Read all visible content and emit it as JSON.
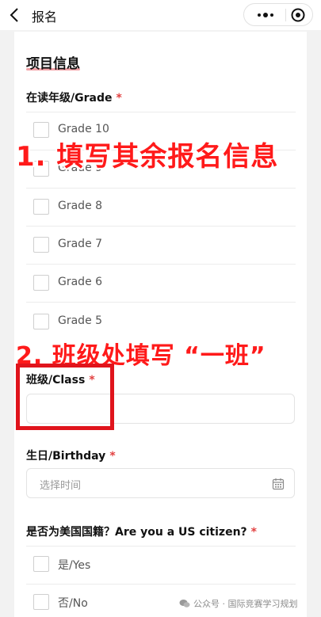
{
  "nav": {
    "title": "报名"
  },
  "section": {
    "title": "项目信息"
  },
  "grade": {
    "label": "在读年级/Grade",
    "required_mark": "*",
    "options": [
      "Grade 10",
      "Grade 9",
      "Grade 8",
      "Grade 7",
      "Grade 6",
      "Grade 5"
    ]
  },
  "class_field": {
    "label": "班级/Class",
    "required_mark": "*",
    "value": ""
  },
  "birthday": {
    "label": "生日/Birthday",
    "required_mark": "*",
    "placeholder": "选择时间"
  },
  "citizen": {
    "label": "是否为美国国籍？Are you a US citizen?",
    "required_mark": "*",
    "options": [
      "是/Yes",
      "否/No"
    ]
  },
  "annotations": {
    "step1": "1. 填写其余报名信息",
    "step2": "2. 班级处填写 “一班”"
  },
  "watermark": {
    "text": "公众号 · 国际竞赛学习规划"
  },
  "colors": {
    "required": "#e24040",
    "annotation": "#ff1a1a",
    "highlight_box": "#e0141c"
  },
  "icons": {
    "back": "back-arrow-icon",
    "more": "more-dots-icon",
    "close": "close-circle-icon",
    "calendar": "calendar-icon",
    "wechat": "wechat-icon"
  }
}
